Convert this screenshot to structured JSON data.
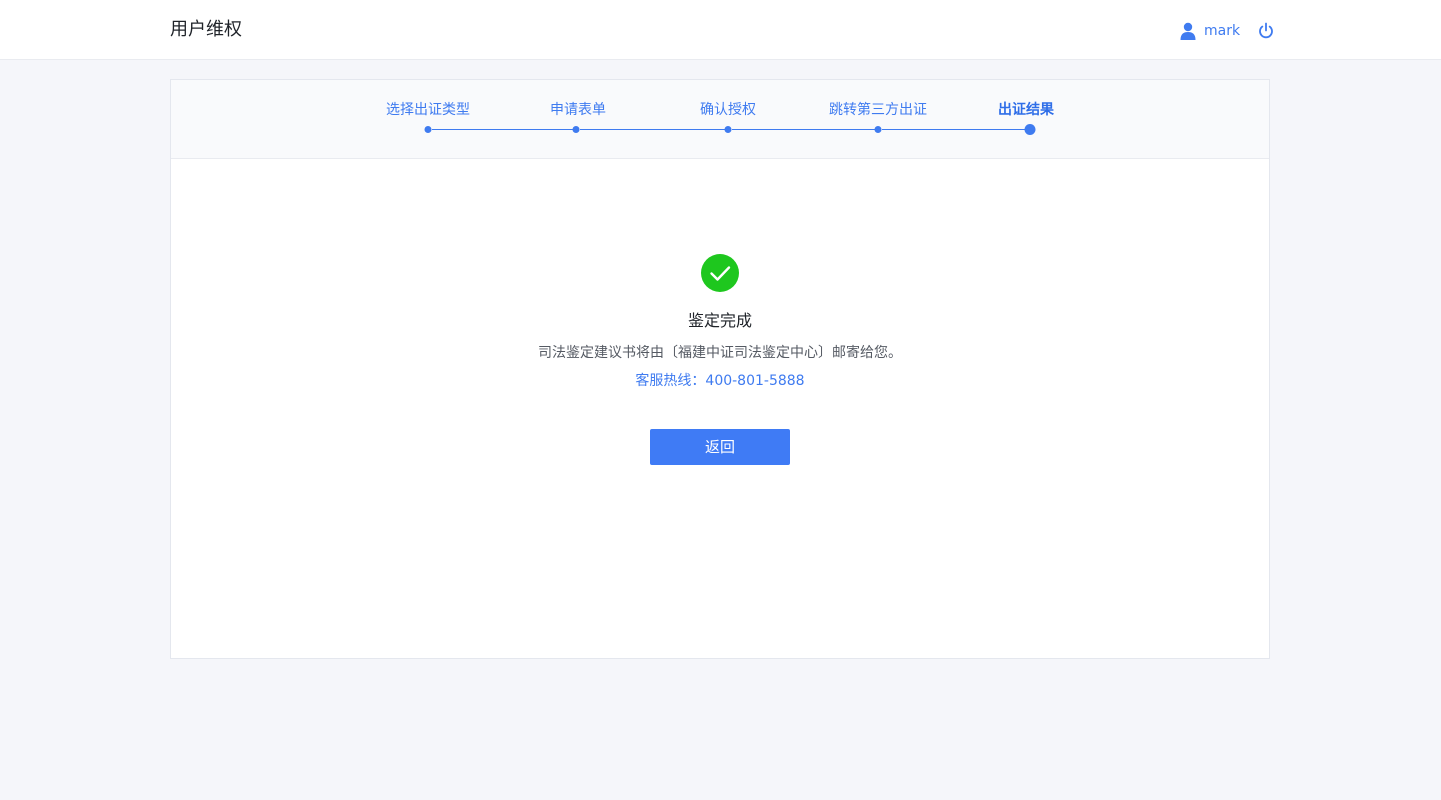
{
  "header": {
    "title": "用户维权",
    "username": "mark",
    "user_icon": "user-icon",
    "logout_icon": "power-icon"
  },
  "steps": [
    {
      "label": "选择出证类型",
      "state": "done"
    },
    {
      "label": "申请表单",
      "state": "done"
    },
    {
      "label": "确认授权",
      "state": "done"
    },
    {
      "label": "跳转第三方出证",
      "state": "done"
    },
    {
      "label": "出证结果",
      "state": "active"
    }
  ],
  "result": {
    "icon": "check-circle-icon",
    "title": "鉴定完成",
    "description": "司法鉴定建议书将由〔福建中证司法鉴定中心〕邮寄给您。",
    "hotline": "客服热线：400-801-5888",
    "back_label": "返回"
  },
  "colors": {
    "accent": "#3f7bf0",
    "success": "#1ec71e",
    "background": "#f5f6fa"
  }
}
